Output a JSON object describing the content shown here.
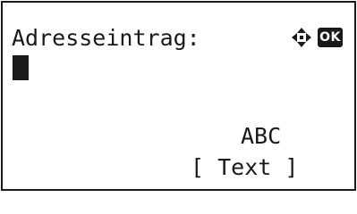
{
  "screen": {
    "title": "Adresseintrag:",
    "entry_value": "",
    "input_mode": "ABC",
    "softkey": {
      "open_bracket": "[",
      "label": "Text",
      "close_bracket": "]"
    },
    "nav": {
      "dpad_icon": "four-way-arrows-icon",
      "ok_label": "OK"
    }
  }
}
